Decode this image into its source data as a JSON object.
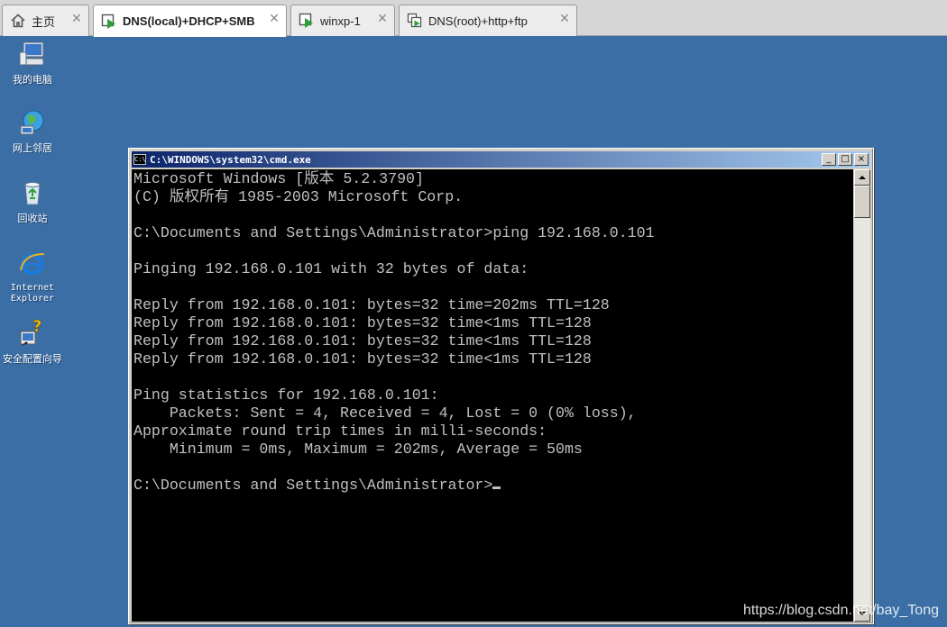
{
  "tabs": [
    {
      "label": "主页",
      "icon": "home-icon",
      "active": false
    },
    {
      "label": "DNS(local)+DHCP+SMB",
      "icon": "vm-play-icon",
      "active": true
    },
    {
      "label": "winxp-1",
      "icon": "vm-play-icon",
      "active": false
    },
    {
      "label": "DNS(root)+http+ftp",
      "icon": "vm-pair-icon",
      "active": false
    }
  ],
  "desktop": {
    "icons": [
      {
        "label": "我的电脑",
        "icon": "my-computer-icon"
      },
      {
        "label": "网上邻居",
        "icon": "network-places-icon"
      },
      {
        "label": "回收站",
        "icon": "recycle-bin-icon"
      },
      {
        "label": "Internet\nExplorer",
        "icon": "internet-explorer-icon"
      },
      {
        "label": "安全配置向导",
        "icon": "security-wizard-icon"
      }
    ]
  },
  "window": {
    "title": "C:\\WINDOWS\\system32\\cmd.exe",
    "sys_icon_text": "C:\\",
    "buttons": {
      "minimize": "_",
      "maximize": "□",
      "close": "×"
    }
  },
  "console": {
    "lines": [
      "Microsoft Windows [版本 5.2.3790]",
      "(C) 版权所有 1985-2003 Microsoft Corp.",
      "",
      "C:\\Documents and Settings\\Administrator>ping 192.168.0.101",
      "",
      "Pinging 192.168.0.101 with 32 bytes of data:",
      "",
      "Reply from 192.168.0.101: bytes=32 time=202ms TTL=128",
      "Reply from 192.168.0.101: bytes=32 time<1ms TTL=128",
      "Reply from 192.168.0.101: bytes=32 time<1ms TTL=128",
      "Reply from 192.168.0.101: bytes=32 time<1ms TTL=128",
      "",
      "Ping statistics for 192.168.0.101:",
      "    Packets: Sent = 4, Received = 4, Lost = 0 (0% loss),",
      "Approximate round trip times in milli-seconds:",
      "    Minimum = 0ms, Maximum = 202ms, Average = 50ms",
      "",
      "C:\\Documents and Settings\\Administrator>"
    ]
  },
  "watermark": "https://blog.csdn.net/bay_Tong",
  "colors": {
    "desktop": "#3a6ea5",
    "title_start": "#0a246a",
    "title_end": "#a6caf0",
    "console_bg": "#000000",
    "console_fg": "#c0c0c0"
  }
}
